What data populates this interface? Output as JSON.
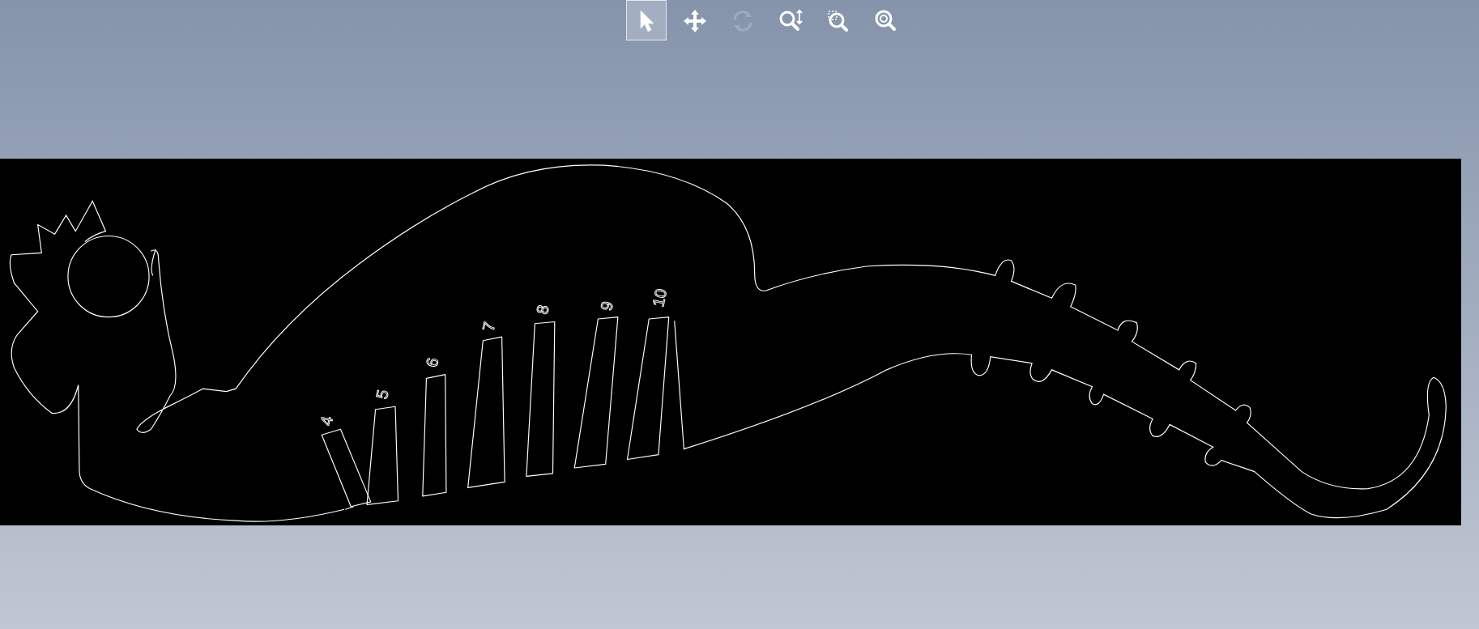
{
  "toolbar": {
    "buttons": [
      {
        "kind": "select",
        "selected": true,
        "disabled": false
      },
      {
        "kind": "pan",
        "selected": false,
        "disabled": false
      },
      {
        "kind": "rotate",
        "selected": false,
        "disabled": true
      },
      {
        "kind": "zoom",
        "selected": false,
        "disabled": false
      },
      {
        "kind": "zoom-window",
        "selected": false,
        "disabled": false
      },
      {
        "kind": "zoom-extents",
        "selected": false,
        "disabled": false
      }
    ]
  },
  "drawing": {
    "slot_labels": [
      "4",
      "5",
      "6",
      "7",
      "8",
      "9",
      "10"
    ]
  }
}
